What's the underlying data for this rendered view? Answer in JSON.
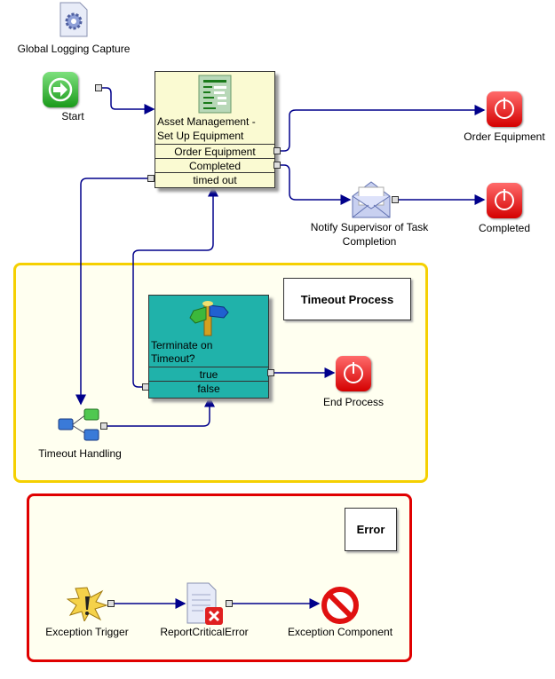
{
  "nodes": {
    "global_logging": "Global Logging Capture",
    "start": "Start",
    "asset": {
      "title_line1": "Asset Management -",
      "title_line2": "Set Up Equipment",
      "outputs": [
        "Order Equipment",
        "Completed",
        "timed out"
      ]
    },
    "order_equipment_end": "Order Equipment",
    "notify_line1": "Notify Supervisor of Task",
    "notify_line2": "Completion",
    "completed_end": "Completed",
    "terminate": {
      "title_line1": "Terminate on",
      "title_line2": "Timeout?",
      "outputs": [
        "true",
        "false"
      ]
    },
    "end_process": "End Process",
    "timeout_handling": "Timeout Handling",
    "exception_trigger": "Exception Trigger",
    "report_error": "ReportCriticalError",
    "exception_component": "Exception Component"
  },
  "groups": {
    "timeout": {
      "label": "Timeout Process",
      "color": "#f5d000"
    },
    "error": {
      "label": "Error",
      "color": "#e00000"
    }
  },
  "colors": {
    "connector": "#00008b",
    "asset_fill": "#fafad2",
    "terminate_fill": "#20b2aa"
  }
}
